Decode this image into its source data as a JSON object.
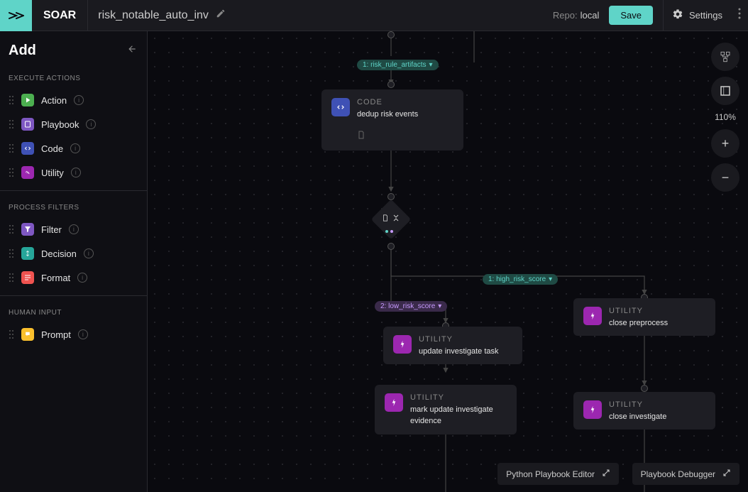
{
  "header": {
    "app_name": "SOAR",
    "playbook_name": "risk_notable_auto_inv",
    "repo_label": "Repo:",
    "repo_value": "local",
    "save_label": "Save",
    "settings_label": "Settings"
  },
  "sidebar": {
    "title": "Add",
    "sections": [
      {
        "label": "EXECUTE ACTIONS",
        "items": [
          {
            "label": "Action",
            "chip": "chip-green"
          },
          {
            "label": "Playbook",
            "chip": "chip-purple"
          },
          {
            "label": "Code",
            "chip": "chip-blue"
          },
          {
            "label": "Utility",
            "chip": "chip-violet"
          }
        ]
      },
      {
        "label": "PROCESS FILTERS",
        "items": [
          {
            "label": "Filter",
            "chip": "chip-purple"
          },
          {
            "label": "Decision",
            "chip": "chip-teal"
          },
          {
            "label": "Format",
            "chip": "chip-red"
          }
        ]
      },
      {
        "label": "HUMAN INPUT",
        "items": [
          {
            "label": "Prompt",
            "chip": "chip-yellow"
          }
        ]
      }
    ]
  },
  "canvas": {
    "zoom": "110%",
    "pills": {
      "top_out": "1: risk_rule_artifacts",
      "high": "1: high_risk_score",
      "low": "2: low_risk_score"
    },
    "nodes": {
      "code": {
        "type": "CODE",
        "title": "dedup risk events"
      },
      "close_pre": {
        "type": "UTILITY",
        "title": "close preprocess"
      },
      "upd_task": {
        "type": "UTILITY",
        "title": "update investigate task"
      },
      "mark_upd": {
        "type": "UTILITY",
        "title": "mark update investigate evidence"
      },
      "close_inv": {
        "type": "UTILITY",
        "title": "close investigate"
      }
    }
  },
  "footer": {
    "python_editor": "Python Playbook Editor",
    "debugger": "Playbook Debugger"
  }
}
